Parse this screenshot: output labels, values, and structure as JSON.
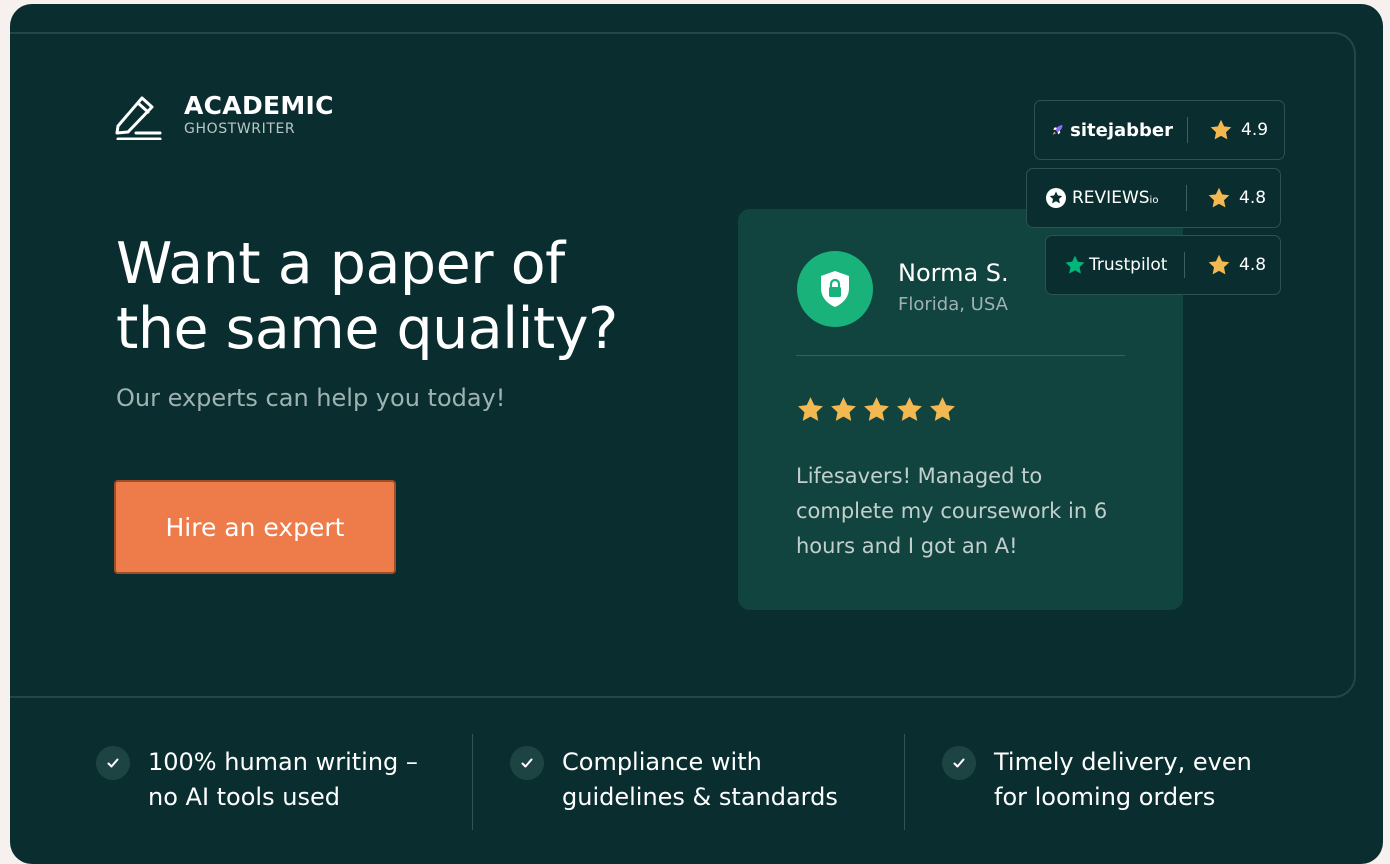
{
  "brand": {
    "name": "ACADEMIC",
    "tagline": "GHOSTWRITER"
  },
  "hero": {
    "headline_line1": "Want a paper of",
    "headline_line2": "the same quality?",
    "subtitle": "Our experts can help you today!",
    "cta_label": "Hire an expert"
  },
  "review": {
    "name": "Norma S.",
    "location": "Florida, USA",
    "rating": 5,
    "text": "Lifesavers! Managed to complete my coursework in 6 hours and I got an A!",
    "avatar_icon": "shield-lock-icon"
  },
  "ratings": [
    {
      "platform": "sitejabber",
      "score": "4.9",
      "icon": "rocket-icon"
    },
    {
      "platform": "REVIEWS",
      "platform_suffix": "io",
      "score": "4.8",
      "icon": "star-circle-icon"
    },
    {
      "platform": "Trustpilot",
      "score": "4.8",
      "icon": "trustpilot-star-icon"
    }
  ],
  "features": [
    {
      "text": "100% human writing – no AI tools used"
    },
    {
      "text": "Compliance with guidelines & standards"
    },
    {
      "text": "Timely delivery, even for looming orders"
    }
  ],
  "colors": {
    "background": "#0a2e2f",
    "card": "#11443f",
    "accent": "#ee7b4a",
    "star": "#f3b950",
    "avatar": "#19b27b",
    "trustpilot": "#00b67a"
  }
}
